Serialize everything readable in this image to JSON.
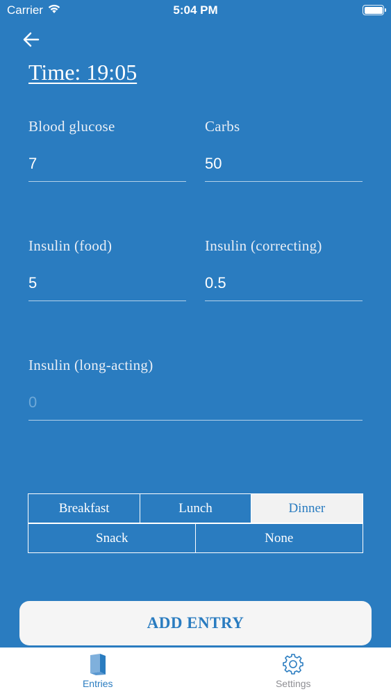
{
  "status_bar": {
    "carrier": "Carrier",
    "time": "5:04 PM"
  },
  "header": {
    "time_title": "Time: 19:05"
  },
  "fields": {
    "blood_glucose": {
      "label": "Blood glucose",
      "value": "7",
      "placeholder": ""
    },
    "carbs": {
      "label": "Carbs",
      "value": "50",
      "placeholder": ""
    },
    "insulin_food": {
      "label": "Insulin (food)",
      "value": "5",
      "placeholder": ""
    },
    "insulin_correcting": {
      "label": "Insulin (correcting)",
      "value": "0.5",
      "placeholder": ""
    },
    "insulin_long": {
      "label": "Insulin (long-acting)",
      "value": "",
      "placeholder": "0"
    }
  },
  "meal_options": {
    "breakfast": "Breakfast",
    "lunch": "Lunch",
    "dinner": "Dinner",
    "snack": "Snack",
    "none": "None",
    "selected": "Dinner"
  },
  "add_entry_label": "ADD ENTRY",
  "tabs": {
    "entries": {
      "label": "Entries",
      "icon": "book-icon"
    },
    "settings": {
      "label": "Settings",
      "icon": "gear-icon"
    }
  },
  "colors": {
    "background": "#2a7cc0",
    "accent": "#2a7cc0",
    "inactive": "#8e8e93"
  }
}
